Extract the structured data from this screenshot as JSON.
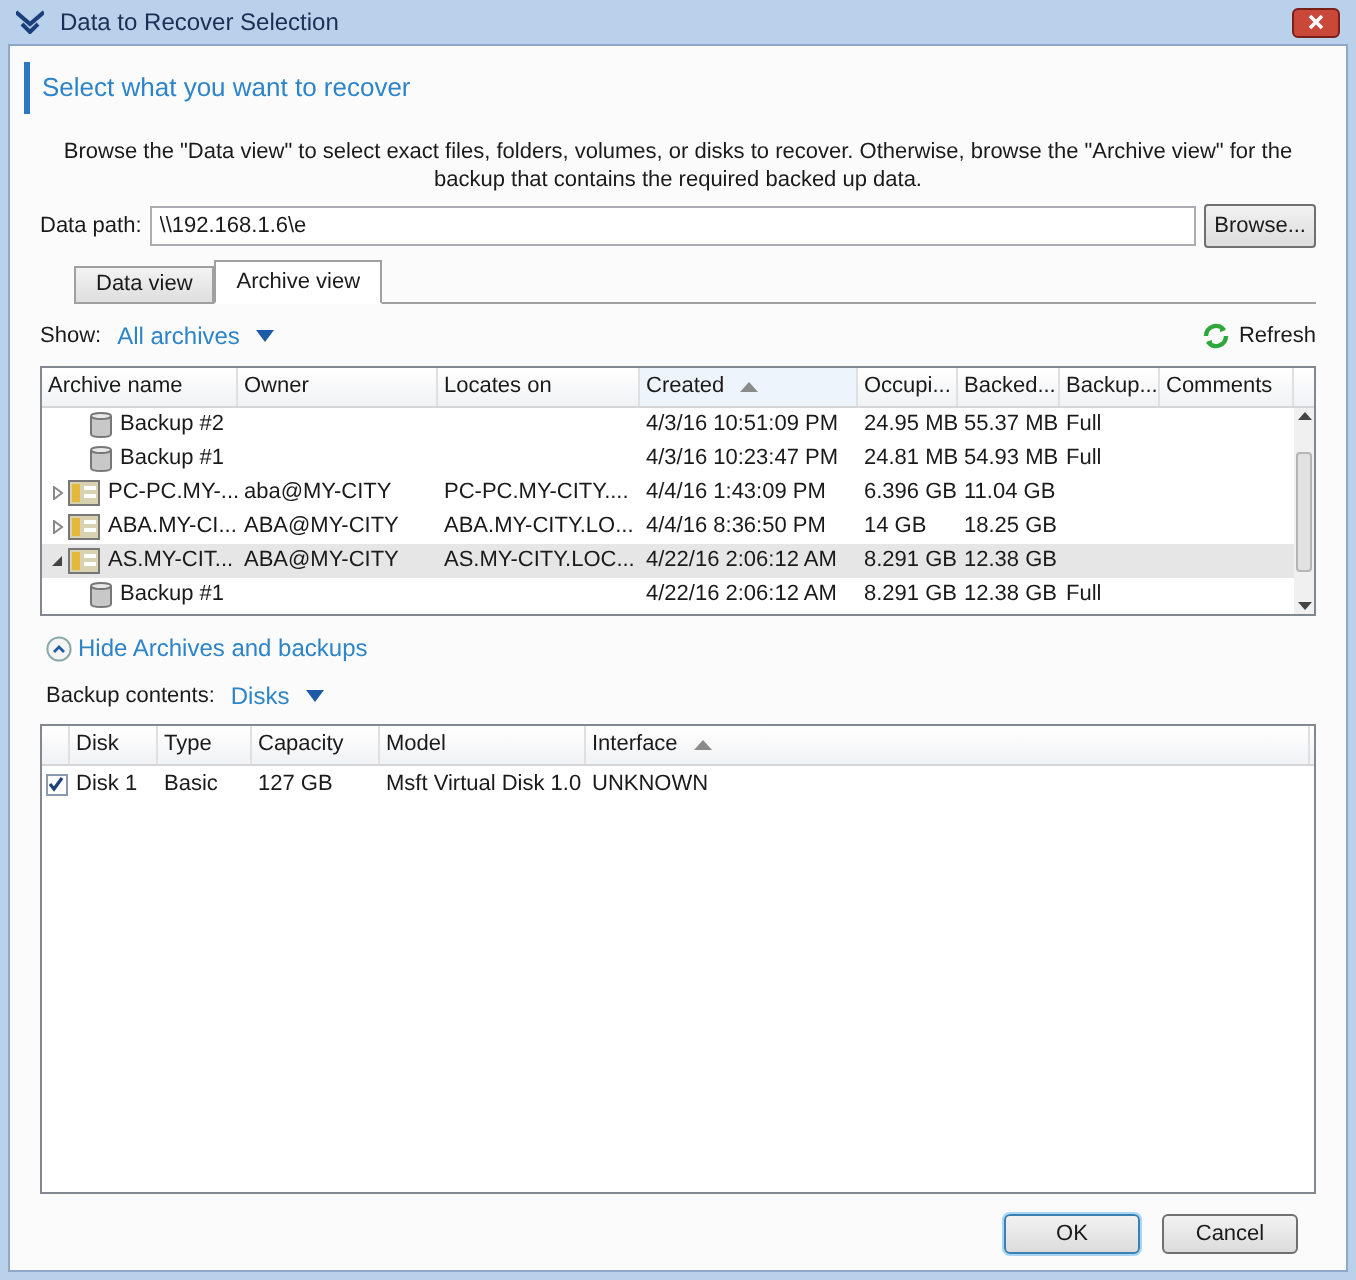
{
  "window": {
    "title": "Data to Recover Selection"
  },
  "heading": "Select what you want to recover",
  "description": "Browse the \"Data view\" to select exact files, folders, volumes, or disks to recover. Otherwise, browse the \"Archive view\" for the backup that contains the required backed up data.",
  "data_path": {
    "label": "Data path:",
    "value": "\\\\192.168.1.6\\e",
    "button": "Browse..."
  },
  "tabs": [
    {
      "label": "Data view",
      "selected": false
    },
    {
      "label": "Archive view",
      "selected": true
    }
  ],
  "show": {
    "label": "Show:",
    "value": "All archives"
  },
  "refresh": "Refresh",
  "archives": {
    "columns": [
      {
        "label": "Archive name",
        "sorted": false
      },
      {
        "label": "Owner",
        "sorted": false
      },
      {
        "label": "Locates on",
        "sorted": false
      },
      {
        "label": "Created",
        "sorted": true
      },
      {
        "label": "Occupi...",
        "sorted": false
      },
      {
        "label": "Backed...",
        "sorted": false
      },
      {
        "label": "Backup...",
        "sorted": false
      },
      {
        "label": "Comments",
        "sorted": false
      }
    ],
    "rows": [
      {
        "kind": "backup",
        "selected": false,
        "cells": [
          "Backup #2",
          "",
          "",
          "4/3/16 10:51:09 PM",
          "24.95 MB",
          "55.37 MB",
          "Full",
          ""
        ]
      },
      {
        "kind": "backup",
        "selected": false,
        "cells": [
          "Backup #1",
          "",
          "",
          "4/3/16 10:23:47 PM",
          "24.81 MB",
          "54.93 MB",
          "Full",
          ""
        ]
      },
      {
        "kind": "archive",
        "expanded": false,
        "selected": false,
        "cells": [
          "PC-PC.MY-...",
          "aba@MY-CITY",
          "PC-PC.MY-CITY....",
          "4/4/16 1:43:09 PM",
          "6.396 GB",
          "11.04 GB",
          "",
          ""
        ]
      },
      {
        "kind": "archive",
        "expanded": false,
        "selected": false,
        "cells": [
          "ABA.MY-CI...",
          "ABA@MY-CITY",
          "ABA.MY-CITY.LO...",
          "4/4/16 8:36:50 PM",
          "14 GB",
          "18.25 GB",
          "",
          ""
        ]
      },
      {
        "kind": "archive",
        "expanded": true,
        "selected": true,
        "cells": [
          "AS.MY-CIT...",
          "ABA@MY-CITY",
          "AS.MY-CITY.LOC...",
          "4/22/16 2:06:12 AM",
          "8.291 GB",
          "12.38 GB",
          "",
          ""
        ]
      },
      {
        "kind": "backup",
        "selected": false,
        "cells": [
          "Backup #1",
          "",
          "",
          "4/22/16 2:06:12 AM",
          "8.291 GB",
          "12.38 GB",
          "Full",
          ""
        ]
      }
    ]
  },
  "hide_link": "Hide Archives and backups",
  "contents": {
    "label": "Backup contents:",
    "value": "Disks",
    "columns": [
      {
        "label": "Disk",
        "sorted": false
      },
      {
        "label": "Type",
        "sorted": false
      },
      {
        "label": "Capacity",
        "sorted": false
      },
      {
        "label": "Model",
        "sorted": false
      },
      {
        "label": "Interface",
        "sorted": true
      }
    ],
    "rows": [
      {
        "checked": true,
        "cells": [
          "Disk 1",
          "Basic",
          "127 GB",
          "Msft Virtual Disk 1.0",
          "UNKNOWN"
        ]
      }
    ]
  },
  "buttons": [
    {
      "label": "OK",
      "default": true
    },
    {
      "label": "Cancel",
      "default": false
    }
  ]
}
